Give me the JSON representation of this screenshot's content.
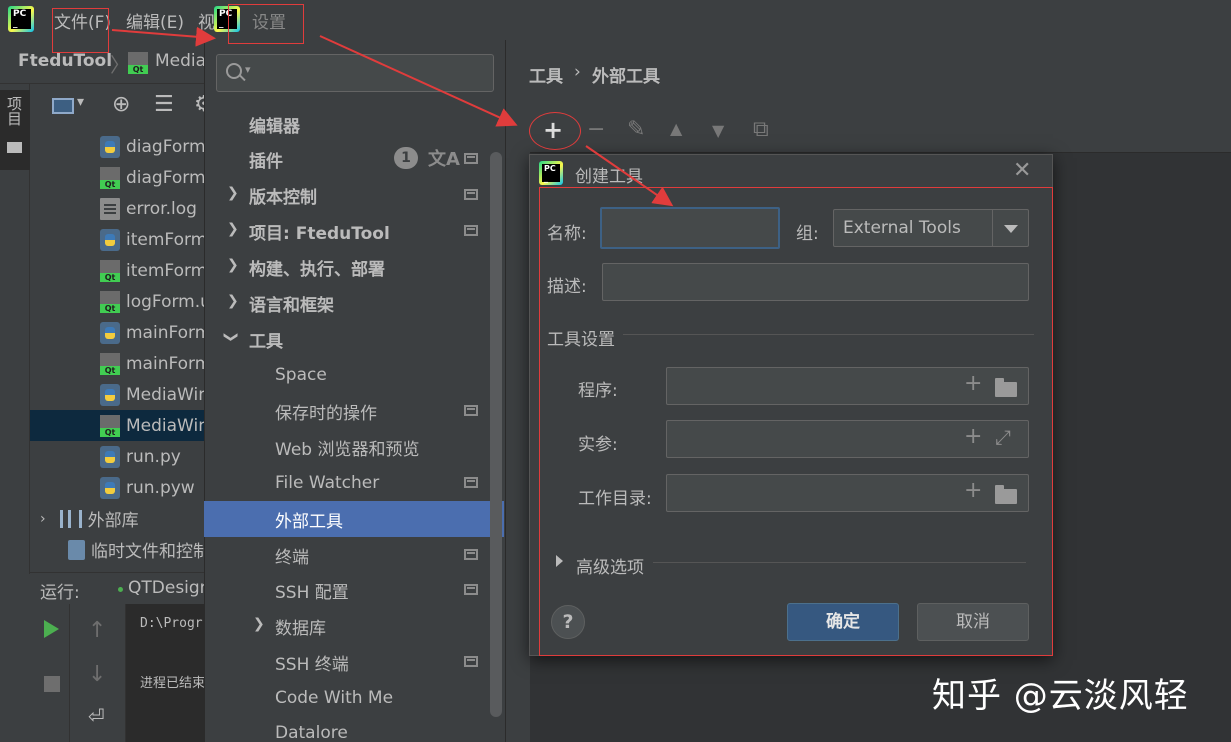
{
  "menubar": {
    "file": "文件(F)",
    "edit": "编辑(E)",
    "view_partial": "视",
    "settings_title": "设置"
  },
  "breadcrumb": {
    "project": "FteduTool",
    "file": "Media"
  },
  "side_tab": {
    "label": "项目"
  },
  "tree": {
    "items": [
      {
        "name": "diagForm",
        "kind": "py"
      },
      {
        "name": "diagForm",
        "kind": "qt"
      },
      {
        "name": "error.log",
        "kind": "log"
      },
      {
        "name": "itemForm",
        "kind": "py"
      },
      {
        "name": "itemForm",
        "kind": "qt"
      },
      {
        "name": "logForm.u",
        "kind": "qt"
      },
      {
        "name": "mainForm",
        "kind": "py"
      },
      {
        "name": "mainForm",
        "kind": "qt"
      },
      {
        "name": "MediaWin",
        "kind": "py"
      },
      {
        "name": "MediaWin",
        "kind": "qt",
        "selected": true
      },
      {
        "name": "run.py",
        "kind": "py"
      },
      {
        "name": "run.pyw",
        "kind": "py"
      }
    ],
    "external_libs": "外部库",
    "scratch": "临时文件和控制"
  },
  "run": {
    "label": "运行:",
    "config": "QTDesign"
  },
  "console": {
    "line1": "D:\\Progr",
    "line2": "进程已结束"
  },
  "settings_nav": {
    "search_placeholder": "",
    "items": {
      "editor": "编辑器",
      "plugins": "插件",
      "plugins_badge": "1",
      "vcs": "版本控制",
      "project": "项目: FteduTool",
      "build": "构建、执行、部署",
      "languages": "语言和框架",
      "tools": "工具",
      "space": "Space",
      "save_actions": "保存时的操作",
      "web_browsers": "Web 浏览器和预览",
      "file_watcher": "File Watcher",
      "external_tools": "外部工具",
      "terminal": "终端",
      "ssh_config": "SSH 配置",
      "database": "数据库",
      "ssh_terminal": "SSH 终端",
      "code_with_me": "Code With Me",
      "datalore": "Datalore"
    }
  },
  "settings_main": {
    "crumb_parent": "工具",
    "crumb_sep": "›",
    "crumb_current": "外部工具"
  },
  "dialog": {
    "title": "创建工具",
    "name_label": "名称:",
    "name_value": "",
    "group_label": "组:",
    "group_value": "External Tools",
    "desc_label": "描述:",
    "desc_value": "",
    "tool_settings": "工具设置",
    "program_label": "程序:",
    "args_label": "实参:",
    "workdir_label": "工作目录:",
    "advanced": "高级选项",
    "help": "?",
    "ok": "确定",
    "cancel": "取消"
  },
  "watermark": "知乎 @云淡风轻",
  "colors": {
    "accent_selected": "#4b6eaf",
    "ok_button": "#365880",
    "annotation_red": "#e03c3c"
  }
}
